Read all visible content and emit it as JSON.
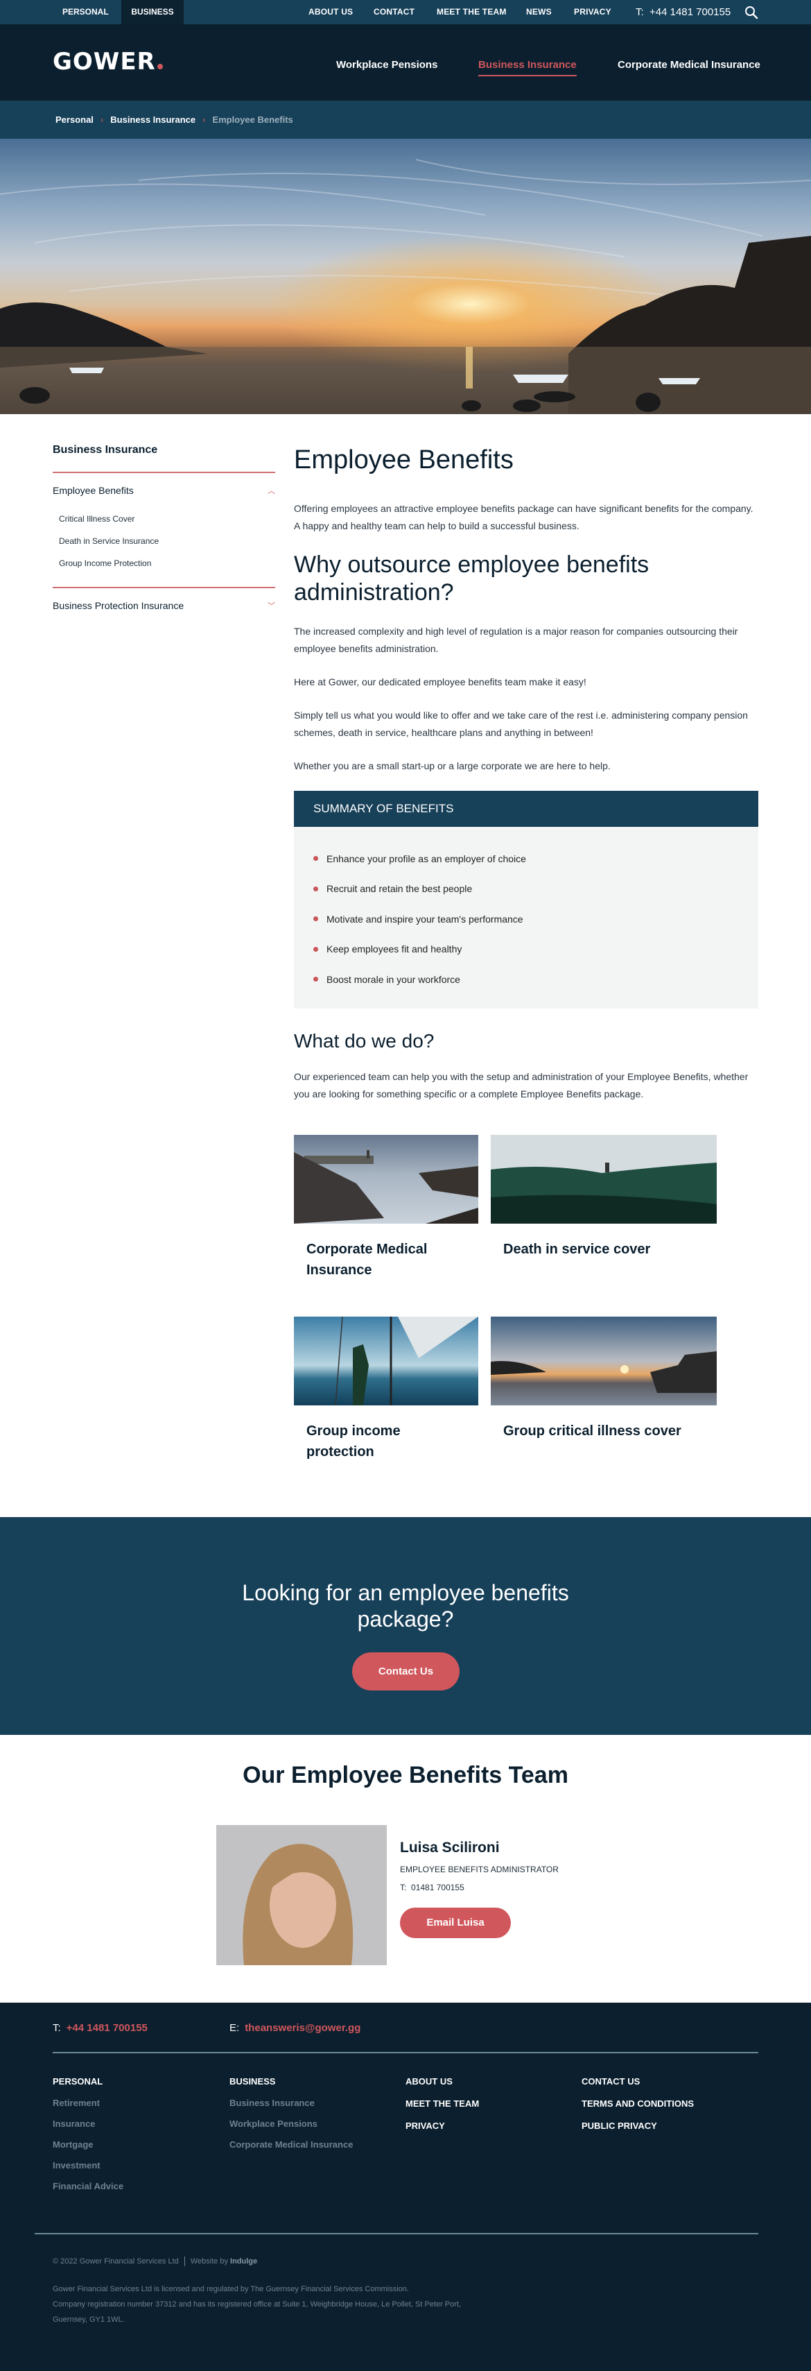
{
  "topbar": {
    "segments": [
      "PERSONAL",
      "BUSINESS"
    ],
    "links": [
      "ABOUT US",
      "CONTACT",
      "MEET THE TEAM",
      "NEWS",
      "PRIVACY"
    ],
    "phone_label": "T:",
    "phone": "+44 1481 700155",
    "search_icon": "search-icon"
  },
  "header": {
    "logo": "GOWER",
    "nav": [
      "Workplace Pensions",
      "Business Insurance",
      "Corporate Medical Insurance"
    ],
    "active_nav": "Business Insurance"
  },
  "breadcrumb": [
    "Personal",
    "Business Insurance",
    "Employee Benefits"
  ],
  "sidebar": {
    "title": "Business Insurance",
    "sections": [
      {
        "label": "Employee Benefits",
        "expanded": true,
        "icon": "chevron-up-icon",
        "items": [
          "Critical Illness Cover",
          "Death in Service Insurance",
          "Group Income Protection"
        ]
      },
      {
        "label": "Business Protection Insurance",
        "expanded": false,
        "icon": "chevron-down-icon"
      }
    ]
  },
  "content": {
    "title": "Employee Benefits",
    "intro": "Offering employees an attractive employee benefits package can have significant benefits for the company. A happy and healthy team can help to build a successful business.",
    "why_title": "Why outsource employee benefits administration?",
    "why_paragraphs": [
      "The increased complexity and high level of regulation is a major reason for companies outsourcing their employee benefits administration.",
      "Here at Gower, our dedicated employee benefits team make it easy!",
      "Simply tell us what you would like to offer and we take care of the rest i.e. administering company pension schemes, death in service, healthcare plans and anything in between!",
      "Whether you are a small start-up or a large corporate we are here to help."
    ],
    "summary": {
      "title": "SUMMARY OF BENEFITS",
      "items": [
        "Enhance your profile as an employer of choice",
        "Recruit and retain the best people",
        "Motivate and inspire your team's performance",
        "Keep employees fit and healthy",
        "Boost morale in your workforce"
      ]
    },
    "what_title": "What do we do?",
    "what_text": "Our experienced team can help you with the setup and administration of your Employee Benefits, whether you are looking for something specific or a complete Employee Benefits package.",
    "cards": [
      {
        "title": "Corporate Medical Insurance",
        "image": "lighthouse-rocks-photo"
      },
      {
        "title": "Death in service cover",
        "image": "surfer-wave-photo"
      },
      {
        "title": "Group income protection",
        "image": "sailing-woman-photo"
      },
      {
        "title": "Group critical illness cover",
        "image": "harbour-sunset-photo"
      }
    ]
  },
  "cta": {
    "title": "Looking for an employee benefits package?",
    "button": "Contact Us"
  },
  "team": {
    "title": "Our Employee Benefits Team",
    "members": [
      {
        "name": "Luisa Scilironi",
        "role": "EMPLOYEE BENEFITS ADMINISTRATOR",
        "phone_label": "T:",
        "phone": "01481 700155",
        "button": "Email Luisa"
      }
    ]
  },
  "footer": {
    "phone_label": "T:",
    "phone": "+44 1481 700155",
    "email_label": "E:",
    "email": "theansweris@gower.gg",
    "columns": [
      {
        "heading": "PERSONAL",
        "links": [
          "Retirement",
          "Insurance",
          "Mortgage",
          "Investment",
          "Financial Advice"
        ]
      },
      {
        "heading": "BUSINESS",
        "links": [
          "Business Insurance",
          "Workplace Pensions",
          "Corporate Medical Insurance"
        ]
      },
      {
        "links": [
          "ABOUT US",
          "MEET THE TEAM",
          "PRIVACY"
        ]
      },
      {
        "links": [
          "CONTACT US",
          "TERMS AND CONDITIONS",
          "PUBLIC PRIVACY"
        ]
      }
    ],
    "copyright": "© 2022 Gower Financial Services Ltd",
    "website_by_label": "Website by",
    "website_by": "Indulge",
    "legal": [
      "Gower Financial Services Ltd is licensed and regulated by The Guernsey Financial Services Commission.",
      "Company registration number 37312 and has its registered office at Suite 1, Weighbridge House, Le Pollet, St Peter Port,",
      "Guernsey, GY1 1WL."
    ]
  },
  "colors": {
    "navy": "#174059",
    "dark_navy": "#0b1f2e",
    "accent": "#d0575c",
    "summary_bg": "#f3f5f5"
  }
}
